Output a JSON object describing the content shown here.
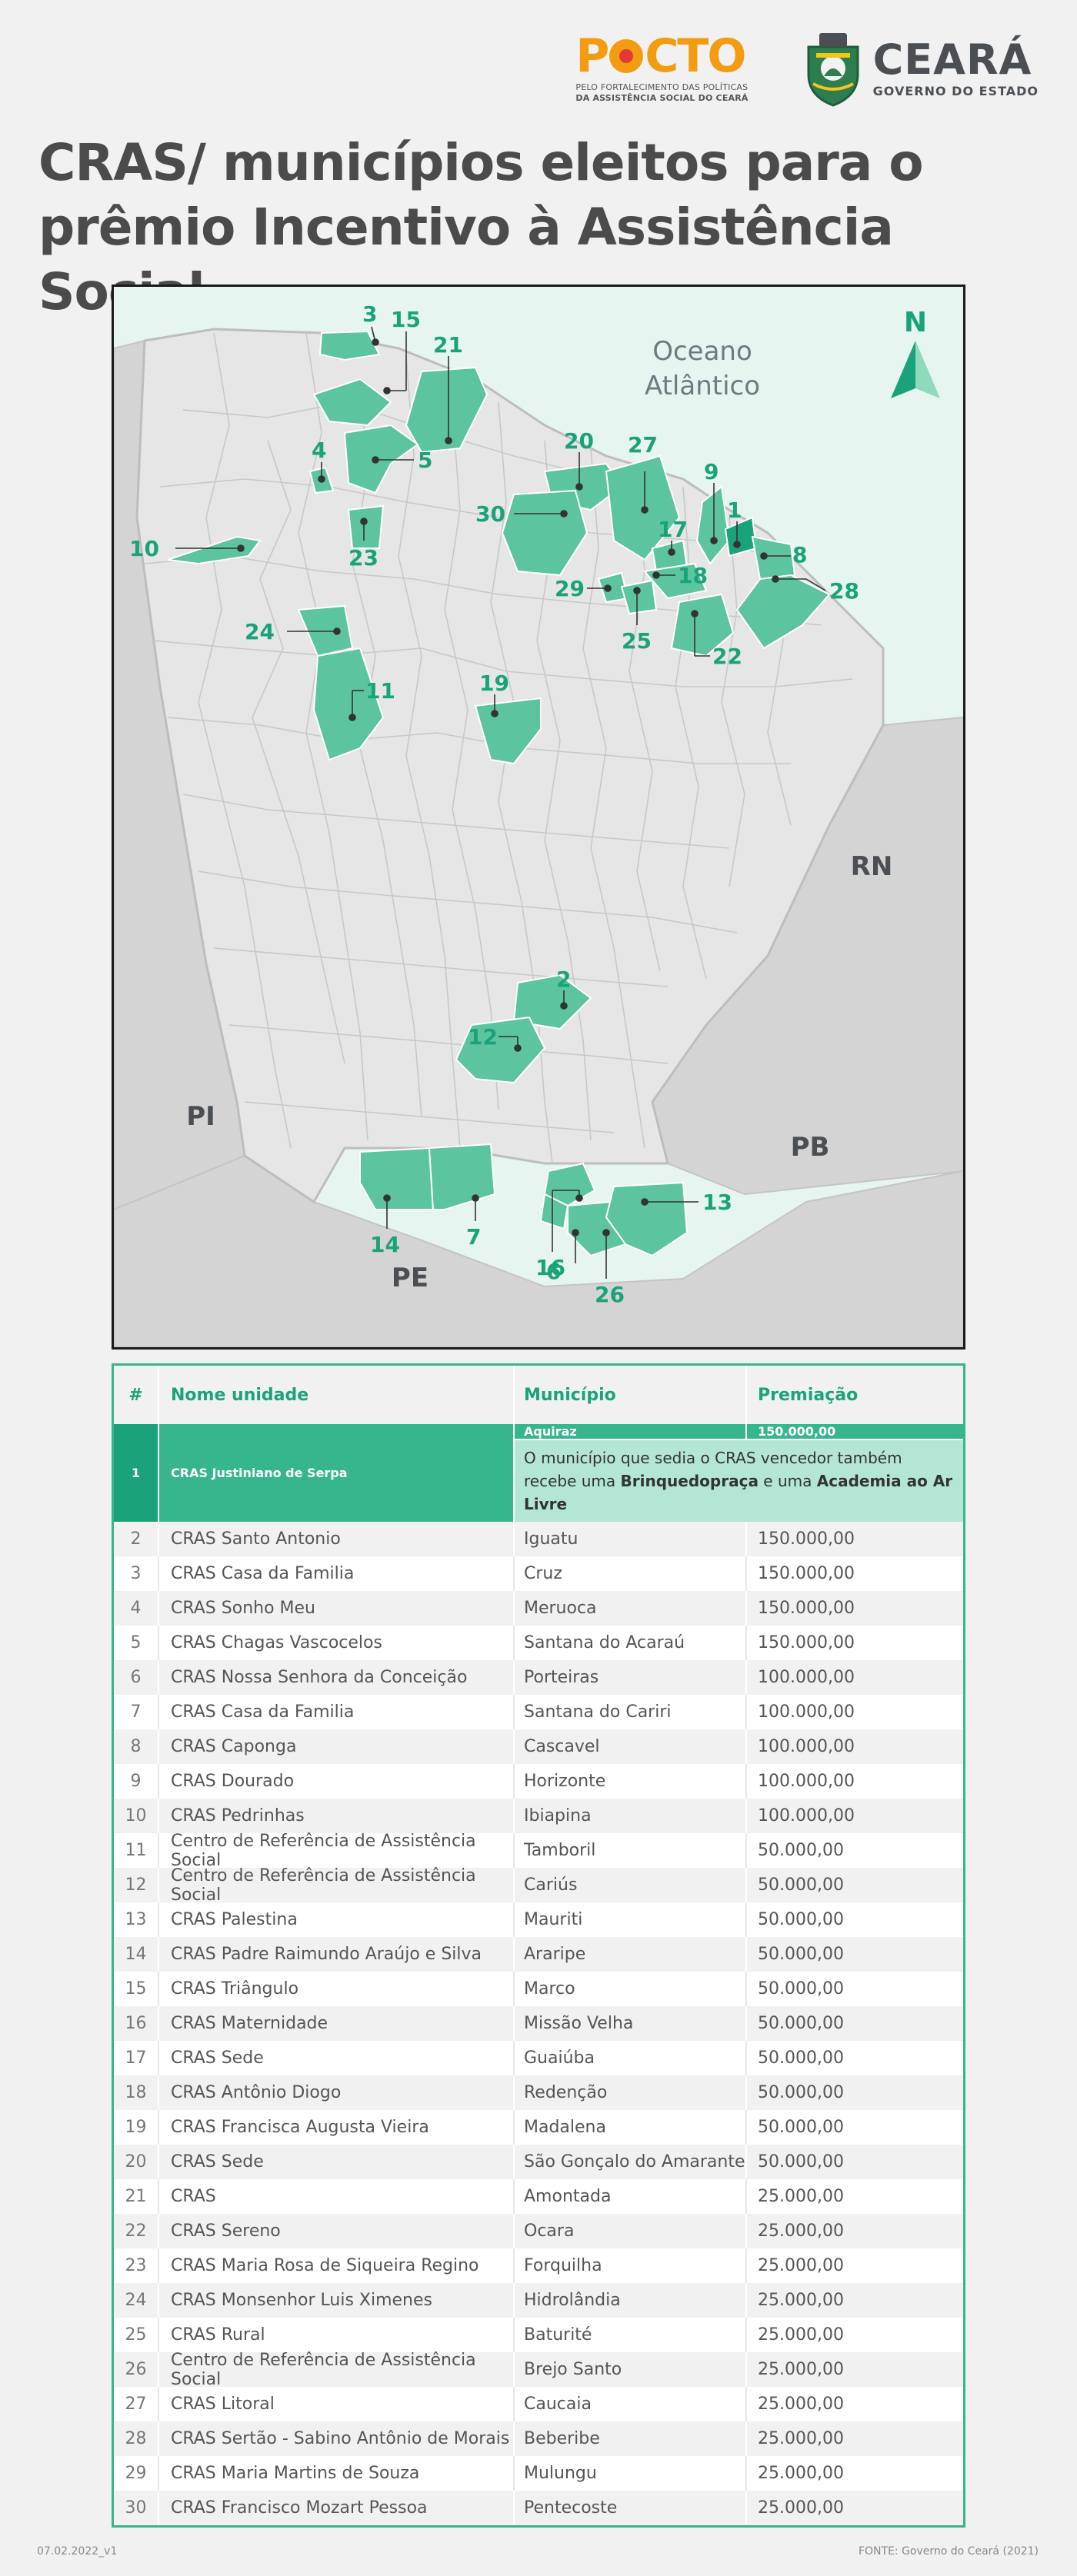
{
  "header": {
    "pacto_logo_text": "PACTO",
    "pacto_tagline_1": "PELO FORTALECIMENTO DAS POLÍTICAS",
    "pacto_tagline_2": "DA ASSISTÊNCIA SOCIAL DO CEARÁ",
    "ceara_logo_text": "CEARÁ",
    "ceara_subtitle": "GOVERNO DO ESTADO"
  },
  "title": "CRAS/ municípios eleitos para o prêmio Incentivo à Assistência Social",
  "map": {
    "compass_label": "N",
    "ocean_label_line1": "Oceano",
    "ocean_label_line2": "Atlântico",
    "neighbor_states": [
      "RN",
      "PI",
      "PB",
      "PE"
    ],
    "colors": {
      "ocean": "#e6f5ef",
      "ceara_land": "#e6e6e6",
      "neighbor_land": "#d4d4d4",
      "highlight": "#5cc49e",
      "winner": "#1aa37a",
      "label": "#1aa37a"
    },
    "markers": [
      "1",
      "2",
      "3",
      "4",
      "5",
      "6",
      "7",
      "8",
      "9",
      "10",
      "11",
      "12",
      "13",
      "14",
      "15",
      "16",
      "17",
      "18",
      "19",
      "20",
      "21",
      "22",
      "23",
      "24",
      "25",
      "26",
      "27",
      "28",
      "29",
      "30"
    ]
  },
  "table": {
    "headers": {
      "num": "#",
      "name": "Nome unidade",
      "municipio": "Município",
      "premiacao": "Premiação"
    },
    "first": {
      "num": "1",
      "name": "CRAS Justiniano de Serpa",
      "municipio": "Aquiraz",
      "premiacao": "150.000,00",
      "note_part1": "O município que sedia o CRAS vencedor também recebe uma ",
      "note_bold1": "Brinquedopraça",
      "note_part2": " e uma ",
      "note_bold2": "Academia ao Ar Livre"
    },
    "rows": [
      {
        "num": "2",
        "name": "CRAS Santo Antonio",
        "municipio": "Iguatu",
        "premiacao": "150.000,00"
      },
      {
        "num": "3",
        "name": "CRAS Casa da Familia",
        "municipio": "Cruz",
        "premiacao": "150.000,00"
      },
      {
        "num": "4",
        "name": "CRAS Sonho Meu",
        "municipio": "Meruoca",
        "premiacao": "150.000,00"
      },
      {
        "num": "5",
        "name": "CRAS Chagas Vascocelos",
        "municipio": "Santana do Acaraú",
        "premiacao": "150.000,00"
      },
      {
        "num": "6",
        "name": "CRAS Nossa Senhora da Conceição",
        "municipio": "Porteiras",
        "premiacao": "100.000,00"
      },
      {
        "num": "7",
        "name": "CRAS Casa da Familia",
        "municipio": "Santana do Cariri",
        "premiacao": "100.000,00"
      },
      {
        "num": "8",
        "name": "CRAS Caponga",
        "municipio": "Cascavel",
        "premiacao": "100.000,00"
      },
      {
        "num": "9",
        "name": "CRAS Dourado",
        "municipio": "Horizonte",
        "premiacao": "100.000,00"
      },
      {
        "num": "10",
        "name": "CRAS Pedrinhas",
        "municipio": "Ibiapina",
        "premiacao": "100.000,00"
      },
      {
        "num": "11",
        "name": "Centro de Referência de Assistência Social",
        "municipio": "Tamboril",
        "premiacao": "50.000,00"
      },
      {
        "num": "12",
        "name": "Centro de Referência de Assistência Social",
        "municipio": "Cariús",
        "premiacao": "50.000,00"
      },
      {
        "num": "13",
        "name": "CRAS Palestina",
        "municipio": "Mauriti",
        "premiacao": "50.000,00"
      },
      {
        "num": "14",
        "name": "CRAS Padre Raimundo Araújo e Silva",
        "municipio": "Araripe",
        "premiacao": "50.000,00"
      },
      {
        "num": "15",
        "name": "CRAS Triângulo",
        "municipio": "Marco",
        "premiacao": "50.000,00"
      },
      {
        "num": "16",
        "name": "CRAS Maternidade",
        "municipio": "Missão Velha",
        "premiacao": "50.000,00"
      },
      {
        "num": "17",
        "name": "CRAS Sede",
        "municipio": "Guaiúba",
        "premiacao": "50.000,00"
      },
      {
        "num": "18",
        "name": "CRAS Antônio Diogo",
        "municipio": "Redenção",
        "premiacao": "50.000,00"
      },
      {
        "num": "19",
        "name": "CRAS Francisca Augusta Vieira",
        "municipio": "Madalena",
        "premiacao": "50.000,00"
      },
      {
        "num": "20",
        "name": "CRAS Sede",
        "municipio": "São Gonçalo do Amarante",
        "premiacao": "50.000,00"
      },
      {
        "num": "21",
        "name": "CRAS",
        "municipio": "Amontada",
        "premiacao": "25.000,00"
      },
      {
        "num": "22",
        "name": "CRAS Sereno",
        "municipio": "Ocara",
        "premiacao": "25.000,00"
      },
      {
        "num": "23",
        "name": "CRAS Maria Rosa de Siqueira Regino",
        "municipio": "Forquilha",
        "premiacao": "25.000,00"
      },
      {
        "num": "24",
        "name": "CRAS Monsenhor Luis Ximenes",
        "municipio": "Hidrolândia",
        "premiacao": "25.000,00"
      },
      {
        "num": "25",
        "name": "CRAS Rural",
        "municipio": "Baturité",
        "premiacao": "25.000,00"
      },
      {
        "num": "26",
        "name": "Centro de Referência de Assistência Social",
        "municipio": "Brejo Santo",
        "premiacao": "25.000,00"
      },
      {
        "num": "27",
        "name": "CRAS Litoral",
        "municipio": "Caucaia",
        "premiacao": "25.000,00"
      },
      {
        "num": "28",
        "name": "CRAS Sertão - Sabino Antônio de Morais",
        "municipio": "Beberibe",
        "premiacao": "25.000,00"
      },
      {
        "num": "29",
        "name": "CRAS Maria Martins de Souza",
        "municipio": "Mulungu",
        "premiacao": "25.000,00"
      },
      {
        "num": "30",
        "name": "CRAS Francisco Mozart Pessoa",
        "municipio": "Pentecoste",
        "premiacao": "25.000,00"
      }
    ]
  },
  "footer": {
    "version": "07.02.2022_v1",
    "source": "FONTE: Governo do Ceará (2021)"
  }
}
